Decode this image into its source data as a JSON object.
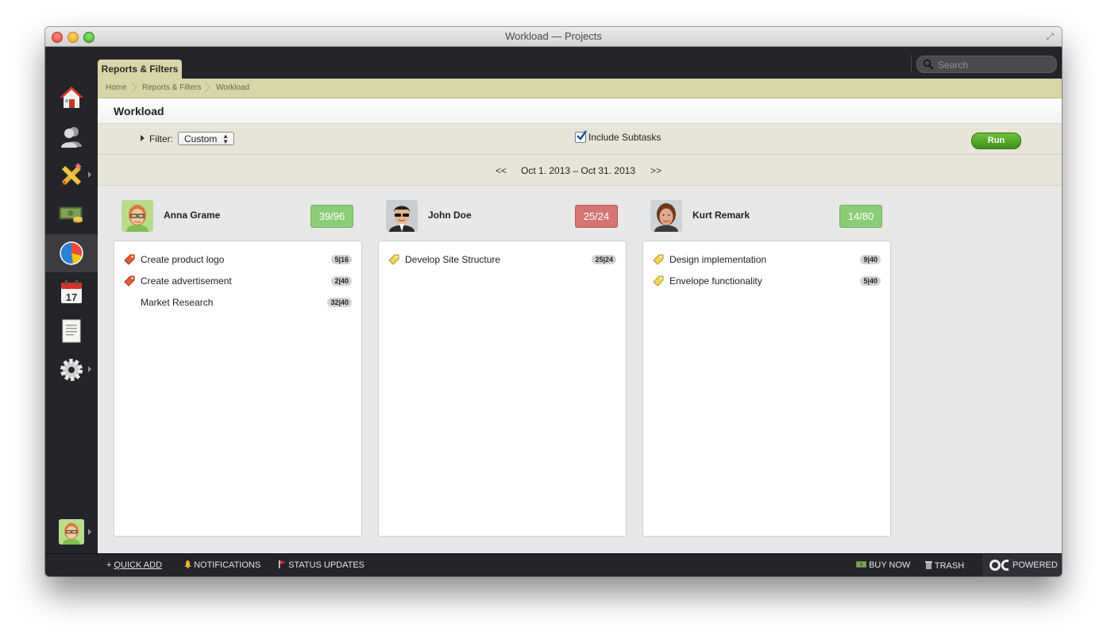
{
  "window": {
    "title": "Workload — Projects"
  },
  "topbar": {
    "tab_label": "Reports & Filters",
    "search_placeholder": "Search"
  },
  "breadcrumb": [
    "Home",
    "Reports & Filters",
    "Workload"
  ],
  "page": {
    "title": "Workload"
  },
  "filter": {
    "label": "Filter:",
    "selected": "Custom",
    "include_subtasks_label": "Include Subtasks",
    "include_subtasks_checked": true,
    "run_label": "Run"
  },
  "date_nav": {
    "prev": "<<",
    "range": "Oct 1. 2013 – Oct 31. 2013",
    "next": ">>"
  },
  "sidebar": {
    "items": [
      "home-icon",
      "people-icon",
      "tools-icon",
      "money-icon",
      "reports-pie-icon",
      "calendar-icon",
      "notes-icon",
      "settings-gear-icon"
    ],
    "calendar_day": "17",
    "active_index": 4
  },
  "people": [
    {
      "name": "Anna Grame",
      "load": "39/96",
      "status": "ok",
      "tasks": [
        {
          "name": "Create product logo",
          "done": "5",
          "total": "16",
          "tag": "red"
        },
        {
          "name": "Create advertisement",
          "done": "2",
          "total": "40",
          "tag": "red"
        },
        {
          "name": "Market Research",
          "done": "32",
          "total": "40",
          "tag": "none"
        }
      ]
    },
    {
      "name": "John Doe",
      "load": "25/24",
      "status": "over",
      "tasks": [
        {
          "name": "Develop Site Structure",
          "done": "25",
          "total": "24",
          "tag": "yellow"
        }
      ]
    },
    {
      "name": "Kurt Remark",
      "load": "14/80",
      "status": "ok",
      "tasks": [
        {
          "name": "Design implementation",
          "done": "9",
          "total": "40",
          "tag": "yellow"
        },
        {
          "name": "Envelope functionality",
          "done": "5",
          "total": "40",
          "tag": "yellow"
        }
      ]
    }
  ],
  "bottombar": {
    "quick_add_plus": "+",
    "quick_add": "QUICK ADD",
    "notifications": "NOTIFICATIONS",
    "status_updates": "STATUS UPDATES",
    "buy_now": "BUY NOW",
    "trash": "TRASH",
    "powered": "POWERED"
  },
  "colors": {
    "accent_green": "#3f8f1b",
    "load_ok": "#8bcd77",
    "load_over": "#d57573",
    "chrome_dark": "#23252b",
    "breadcrumb_bg": "#d8d5a8"
  }
}
